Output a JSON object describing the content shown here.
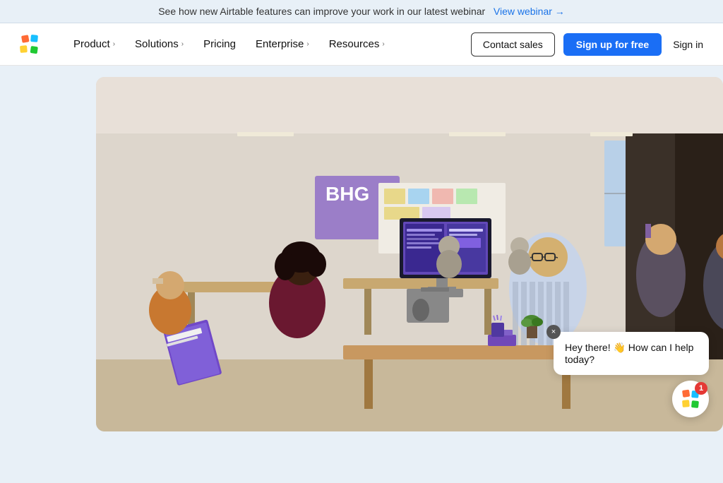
{
  "announcement": {
    "text": "See how new Airtable features can improve your work in our latest webinar",
    "link_text": "View webinar →"
  },
  "nav": {
    "product_label": "Product",
    "solutions_label": "Solutions",
    "pricing_label": "Pricing",
    "enterprise_label": "Enterprise",
    "resources_label": "Resources",
    "contact_sales_label": "Contact sales",
    "signup_label": "Sign up for free",
    "signin_label": "Sign in"
  },
  "chat": {
    "message": "Hey there! 👋 How can I help today?",
    "close_label": "×",
    "badge_count": "1"
  }
}
